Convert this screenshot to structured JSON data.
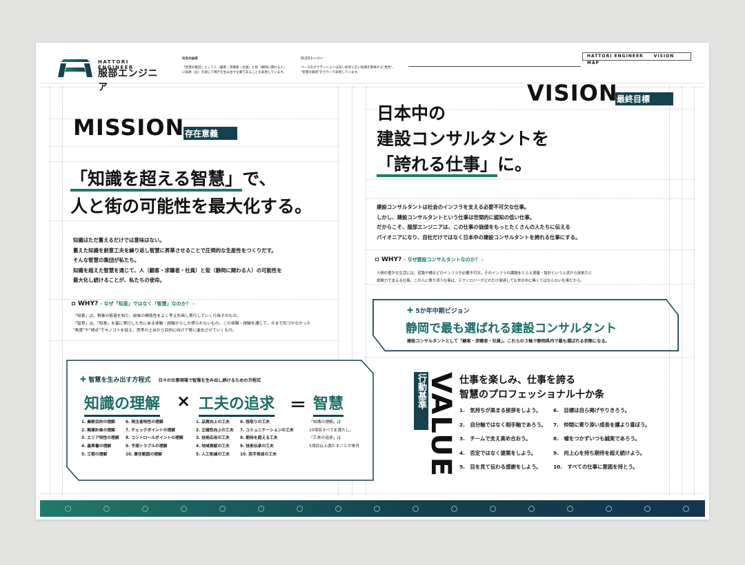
{
  "header": {
    "logo_en": "HATTORI ENGINEER",
    "logo_ja": "服部エンジニア",
    "company_name_heading": "社名の由来",
    "company_name_text_1": "「智慧の集団」として人（顧客・求職者・社員）と街（静岡に関わる人）",
    "company_name_text_2": "に知恵（光）を通じて輝きを生み出す企業であることを表現しています。",
    "logo_story_heading": "ロゴストーリー",
    "logo_story_text_1": "ベースのグラデーションは深い思考と広い知識を象徴する\"青色\"、",
    "logo_story_text_2": "\"智慧の集結\"をカラーで表現しています。",
    "right_en": "HATTORI ENGINEER",
    "right_map": "VISION MAP"
  },
  "mission": {
    "title_en": "MISSION",
    "title_ja": "存在意義",
    "headline_bracket": "「知識を超える智慧」",
    "headline_rest_1": "で、",
    "headline_line_2": "人と街の可能性を最大化する。",
    "body": [
      "知識はただ蓄えるだけでは意味はない。",
      "蓄えた知識を創意工夫を繰り返し智慧に昇華させることで圧倒的な生産性をつくりだす。",
      "そんな智慧の集団が私たち。",
      "知識を超えた智慧を通じて、人（顧客・求職者・社員）と街（静岡に関わる人）の可能性を",
      "最大化し続けることが、私たちの使命。"
    ],
    "why_label": "WHY?",
    "why_question": "- なぜ「知恵」ではなく「智慧」なのか？ -",
    "why_text": [
      "「知恵」は、物事の筋道を知り、前後の関係性をよく考え計画し実行していく行為そのもの。",
      "「智慧」は、「知恵」を基に実行した先にある体験・経験からしか得られないもの。この体験・経験を通じて、今まで気づかなかった",
      "\"角度\"や\"視点\"でモノゴトを捉え、思考の土台から目的に向けて常に進化させていくもの。"
    ]
  },
  "vision": {
    "title_en": "VISION",
    "title_ja": "最終目標",
    "headline_1": "日本中の",
    "headline_2": "建設コンサルタントを",
    "headline_bracket": "「誇れる仕事」",
    "headline_rest_3": "に。",
    "body": [
      "建設コンサルタントは社会のインフラを支える必要不可欠な仕事。",
      "しかし、建設コンサルタントという仕事は世間的に認知の低い仕事。",
      "だからこそ、服部エンジニアは、この仕事の価値をもっとたくさんの人たちに伝える",
      "パイオニアになり、自社だけではなく日本中の建設コンサルタントを誇れる仕事にする。"
    ],
    "why_label": "WHY?",
    "why_question": "- なぜ建設コンサルタントなのか？ -",
    "why_text": [
      "人間の豊かな生活には、道路や橋などのインフラが必要不可欠。そのインフラの課題をとらえ測量・設計という上流から技術力と",
      "提案力で支える仕事。この人に寄り添う仕事は、テクノロジーがどれだけ発達しても世の中に無くてはならない仕事だから。"
    ]
  },
  "midterm": {
    "label": "5か年中期ビジョン",
    "headline": "静岡で最も選ばれる建設コンサルタント",
    "text": "建設コンサルタントとして「顧客・求職者・社員」。これらの３軸で静岡県内で最も選ばれる状態になる。"
  },
  "formula": {
    "label": "智慧を生み出す方程式",
    "sub": "日々の仕事現場で智慧を生み出し続けるための方程式",
    "word_1": "知識の理解",
    "op_1": "×",
    "word_2": "工夫の追求",
    "op_2": "＝",
    "word_3": "智慧",
    "list_a": [
      "1. 業務目的の理解",
      "2. 関連計画の理解",
      "3. エリア特性の理解",
      "4. 基準書の理解",
      "5. 工程の理解"
    ],
    "list_b": [
      "6. 発注者特性の理解",
      "7. チェックポイントの理解",
      "8. コントロールポイントの理解",
      "9. 予測トラブルの理解",
      "10. 責任範囲の理解"
    ],
    "list_c": [
      "1. 品質向上の工夫",
      "2. 正確性向上の工夫",
      "3. 技術応用の工夫",
      "4. 地域貢献の工夫",
      "5. 人工削減の工夫"
    ],
    "list_d": [
      "6. 段取りの工夫",
      "7. コミュニケーションの工夫",
      "8. 期待を超える工夫",
      "9. 技術伝承の工夫",
      "10. 若手育成の工夫"
    ],
    "note": [
      "「知識の理解」は",
      "10項目すべてを満たし、",
      "「工夫の追求」は",
      "5項目以上満たすことが条件"
    ]
  },
  "value": {
    "title_en": "VALUE",
    "title_ja": "行動基準",
    "headline_1": "仕事を楽しみ、仕事を誇る",
    "headline_2": "智慧のプロフェッショナル十か条",
    "list_left": [
      "1.　気持ちが高まる挨拶をしよう。",
      "2.　自分軸ではなく相手軸であろう。",
      "3.　チームで支え高め合おう。",
      "4.　否定ではなく提案をしよう。",
      "5.　目を見て伝わる感謝をしよう。"
    ],
    "list_right": [
      "6.　目標は自ら掲げやりきろう。",
      "7.　仲間に寄り添い成長を護より喜ぼう。",
      "8.　嘘をつかずいつも誠実であろう。",
      "9.　向上心を持ち期待を超え続けよう。",
      "10.　すべての仕事に意図を持とう。"
    ]
  },
  "colors": {
    "teal": "#1f7a6a",
    "navy": "#16414f",
    "footer_end": "#15344d"
  }
}
